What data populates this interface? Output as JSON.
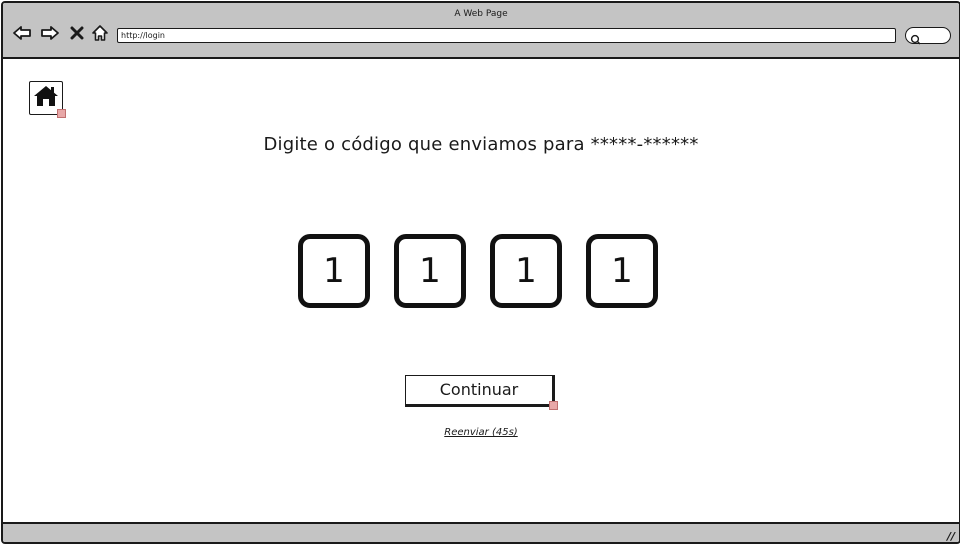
{
  "window": {
    "title": "A Web Page"
  },
  "toolbar": {
    "back_icon": "back-arrow-icon",
    "forward_icon": "forward-arrow-icon",
    "stop_icon": "close-icon",
    "home_icon": "home-outline-icon",
    "url": "http://login",
    "search_icon": "search-icon"
  },
  "page": {
    "home_icon": "home-icon",
    "heading": "Digite o código que enviamos para *****-******",
    "code_digits": [
      "1",
      "1",
      "1",
      "1"
    ],
    "continue_label": "Continuar",
    "resend_label": "Reenviar (45s)"
  },
  "statusbar": {
    "resize_icon": "resize-grip-icon"
  },
  "colors": {
    "chrome": "#c4c4c4",
    "border": "#1a1a1a",
    "link_marker": "#e8a8a8",
    "background": "#ffffff"
  }
}
